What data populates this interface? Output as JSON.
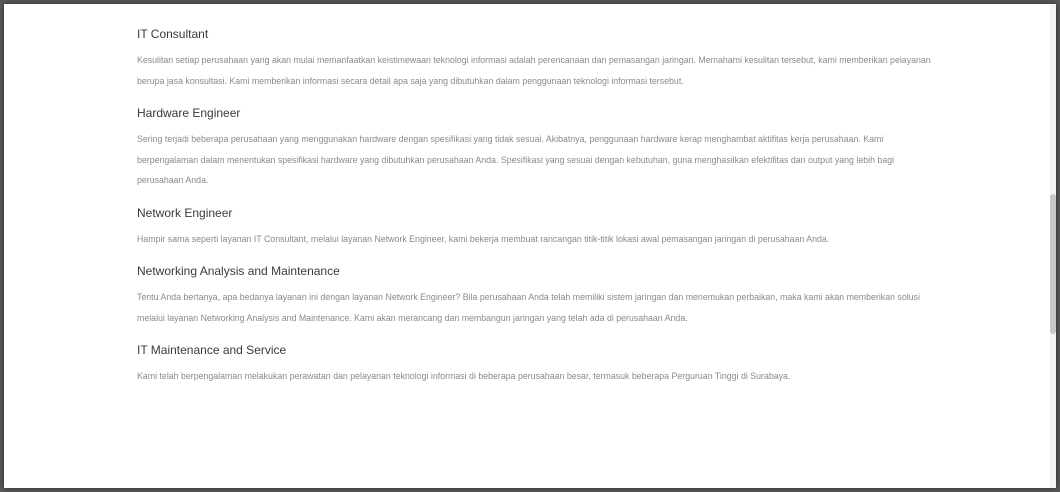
{
  "sections": [
    {
      "title": "IT Consultant",
      "body": "Kesulitan setiap perusahaan yang akan mulai memanfaatkan keistimewaan teknologi informasi adalah perencanaan dan pemasangan jaringan. Memahami kesulitan tersebut, kami memberikan pelayanan berupa jasa konsultasi. Kami memberikan informasi secara detail apa saja yang dibutuhkan dalam penggunaan teknologi informasi tersebut."
    },
    {
      "title": "Hardware Engineer",
      "body": "Sering terjadi beberapa perusahaan yang menggunakan hardware dengan spesifikasi yang tidak sesuai. Akibatnya, penggunaan hardware kerap menghambat aktifitas kerja perusahaan. Kami berpengalaman dalam menentukan spesifikasi hardware yang dibutuhkan perusahaan Anda. Spesifikasi yang sesuai dengan kebutuhan, guna menghasilkan efektifitas dan output yang lebih bagi perusahaan Anda."
    },
    {
      "title": "Network Engineer",
      "body": "Hampir sama seperti layanan IT Consultant, melalui layanan Network Engineer, kami bekerja membuat rancangan titik-titik lokasi awal pemasangan jaringan di perusahaan Anda."
    },
    {
      "title": "Networking Analysis and Maintenance",
      "body": "Tentu Anda bertanya, apa bedanya layanan ini dengan layanan Network Engineer? Bila perusahaan Anda telah memiliki sistem jaringan dan menemukan perbaikan, maka kami akan memberikan solusi melalui layanan Networking Analysis and Maintenance. Kami akan merancang dan membangun jaringan yang telah ada di perusahaan Anda."
    },
    {
      "title": "IT Maintenance and Service",
      "body": "Kami telah berpengalaman melakukan perawatan dan pelayanan teknologi informasi di beberapa perusahaan besar, termasuk beberapa Perguruan Tinggi di Surabaya."
    }
  ]
}
